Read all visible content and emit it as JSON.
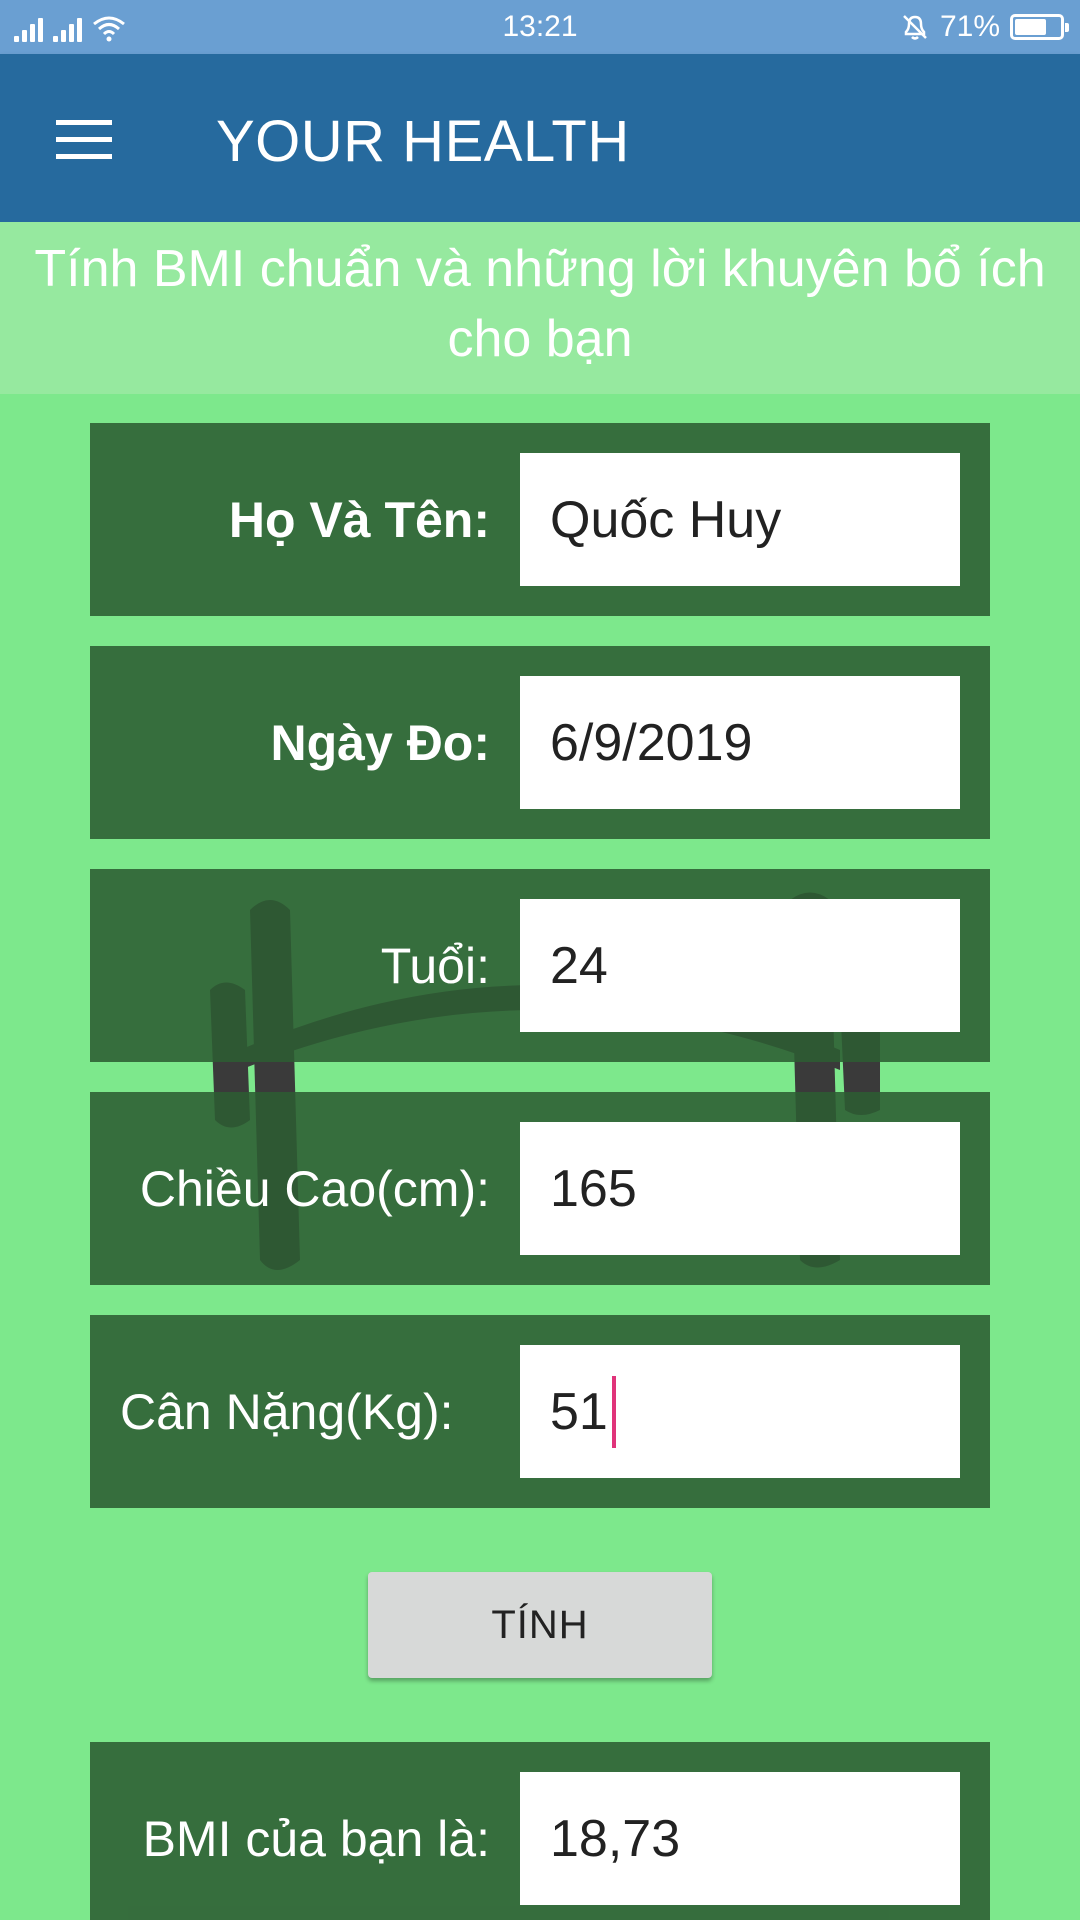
{
  "status_bar": {
    "time": "13:21",
    "battery_percent": "71%",
    "battery_level": 0.71,
    "icons": [
      "signal-icon",
      "signal-icon",
      "wifi-icon",
      "alarm-off-icon",
      "battery-icon"
    ]
  },
  "app_bar": {
    "title": "YOUR HEALTH",
    "menu_icon": "hamburger-menu-icon"
  },
  "subtitle": "Tính BMI chuẩn và những lời khuyên bổ ích cho bạn",
  "form": {
    "name": {
      "label": "Họ Và Tên:",
      "value": "Quốc Huy"
    },
    "date": {
      "label": "Ngày Đo:",
      "value": "6/9/2019"
    },
    "age": {
      "label": "Tuổi:",
      "value": "24"
    },
    "height": {
      "label": "Chiều Cao(cm):",
      "value": "165"
    },
    "weight": {
      "label": "Cân Nặng(Kg):",
      "value": "51"
    }
  },
  "calculate_button": "TÍNH",
  "result": {
    "label": "BMI của bạn là:",
    "value": "18,73"
  },
  "colors": {
    "background": "#7de88c",
    "app_bar": "#266a9e",
    "status_bar": "#6a9fd2",
    "row": "#2c5c32",
    "caret": "#e0337a"
  }
}
